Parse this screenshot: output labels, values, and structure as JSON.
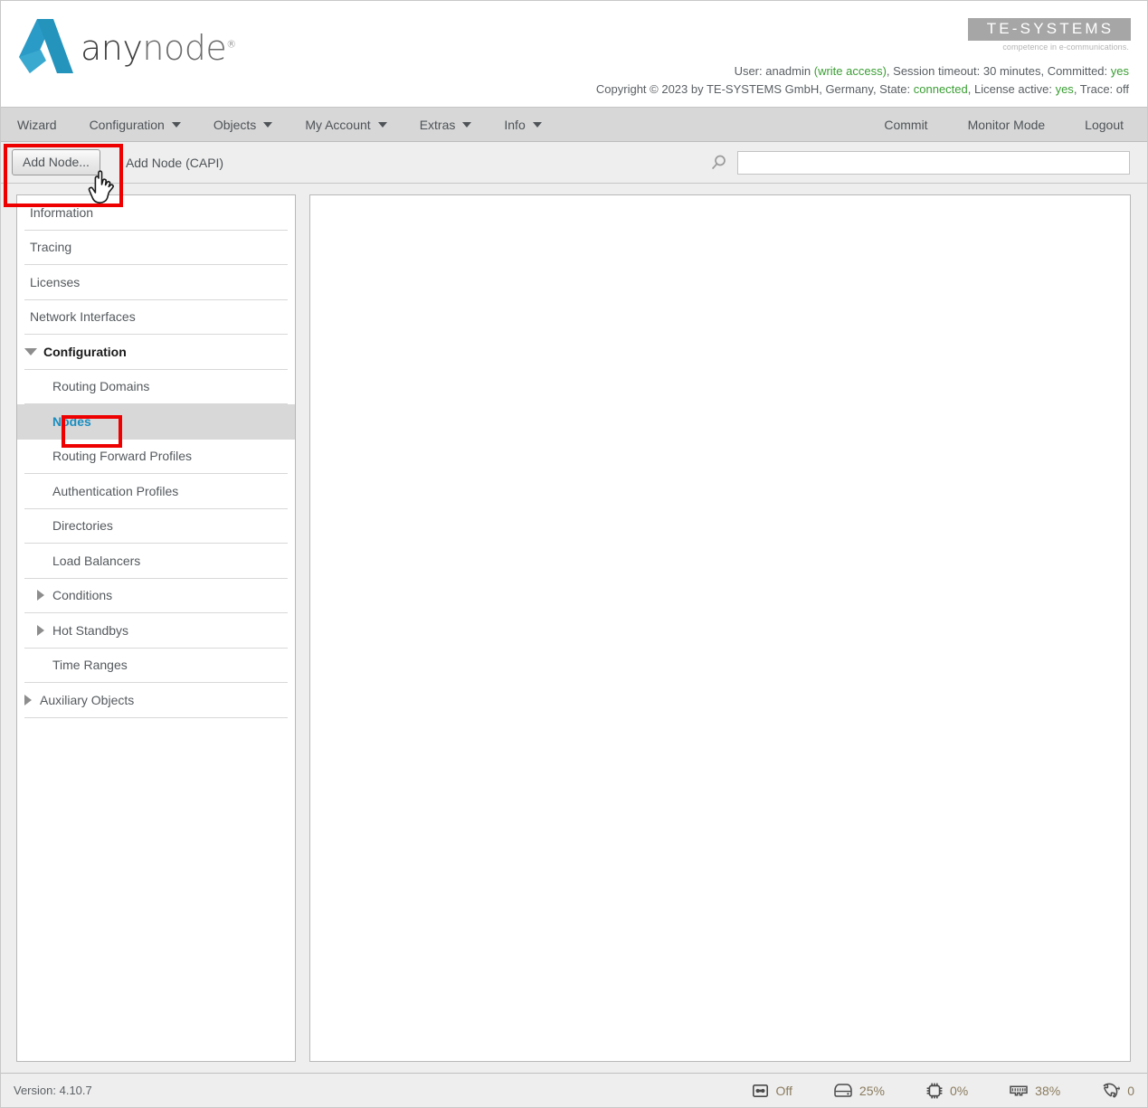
{
  "header": {
    "brand_name_bold": "any",
    "brand_name_light": "node",
    "brand_registered": "®",
    "company_logo_text": "TE-SYSTEMS",
    "company_tagline": "competence in e-communications.",
    "session_line1_prefix": "User: ",
    "session_user": "anadmin",
    "session_access": "(write access)",
    "session_timeout_label": ", Session timeout: ",
    "session_timeout_value": "30 minutes",
    "session_committed_label": ", Committed: ",
    "session_committed_value": "yes",
    "copyright": "Copyright © 2023 by TE-SYSTEMS GmbH, Germany, State: ",
    "state_value": "connected",
    "license_label": ", License active: ",
    "license_value": "yes",
    "trace_label": ", Trace: ",
    "trace_value": "off"
  },
  "menubar": {
    "left_items": [
      {
        "label": "Wizard",
        "has_caret": false
      },
      {
        "label": "Configuration",
        "has_caret": true
      },
      {
        "label": "Objects",
        "has_caret": true
      },
      {
        "label": "My Account",
        "has_caret": true
      },
      {
        "label": "Extras",
        "has_caret": true
      },
      {
        "label": "Info",
        "has_caret": true
      }
    ],
    "right_items": [
      {
        "label": "Commit"
      },
      {
        "label": "Monitor Mode"
      },
      {
        "label": "Logout"
      }
    ]
  },
  "toolbar": {
    "add_node_button": "Add Node...",
    "add_node_capi_link": "Add Node (CAPI)",
    "search_icon": "search-icon",
    "search_value": "",
    "search_placeholder": ""
  },
  "sidebar": {
    "items": [
      {
        "label": "Information",
        "level": 0,
        "arrow": "none",
        "selected": false,
        "bold": false
      },
      {
        "label": "Tracing",
        "level": 0,
        "arrow": "none",
        "selected": false,
        "bold": false
      },
      {
        "label": "Licenses",
        "level": 0,
        "arrow": "none",
        "selected": false,
        "bold": false
      },
      {
        "label": "Network Interfaces",
        "level": 0,
        "arrow": "none",
        "selected": false,
        "bold": false
      },
      {
        "label": "Configuration",
        "level": 0,
        "arrow": "down",
        "selected": false,
        "bold": true
      },
      {
        "label": "Routing Domains",
        "level": 1,
        "arrow": "none",
        "selected": false,
        "bold": false
      },
      {
        "label": "Nodes",
        "level": 1,
        "arrow": "none",
        "selected": true,
        "bold": false
      },
      {
        "label": "Routing Forward Profiles",
        "level": 1,
        "arrow": "none",
        "selected": false,
        "bold": false
      },
      {
        "label": "Authentication Profiles",
        "level": 1,
        "arrow": "none",
        "selected": false,
        "bold": false
      },
      {
        "label": "Directories",
        "level": 1,
        "arrow": "none",
        "selected": false,
        "bold": false
      },
      {
        "label": "Load Balancers",
        "level": 1,
        "arrow": "none",
        "selected": false,
        "bold": false
      },
      {
        "label": "Conditions",
        "level": 1,
        "arrow": "right",
        "selected": false,
        "bold": false
      },
      {
        "label": "Hot Standbys",
        "level": 1,
        "arrow": "right",
        "selected": false,
        "bold": false
      },
      {
        "label": "Time Ranges",
        "level": 1,
        "arrow": "none",
        "selected": false,
        "bold": false
      },
      {
        "label": "Auxiliary Objects",
        "level": 0,
        "arrow": "right",
        "selected": false,
        "bold": false
      }
    ]
  },
  "main": {
    "content": ""
  },
  "statusbar": {
    "version_label": "Version:",
    "version_value": "4.10.7",
    "metrics": [
      {
        "icon": "recording-tape-icon",
        "value": "Off"
      },
      {
        "icon": "harddisk-icon",
        "value": "25%"
      },
      {
        "icon": "cpu-icon",
        "value": "0%"
      },
      {
        "icon": "memory-icon",
        "value": "38%"
      },
      {
        "icon": "phone-calls-icon",
        "value": "0"
      }
    ]
  },
  "annotations": {
    "highlight_color": "#ee0000",
    "highlighted_elements": [
      "Add Node...",
      "Nodes"
    ],
    "cursor": "pointing-hand"
  }
}
